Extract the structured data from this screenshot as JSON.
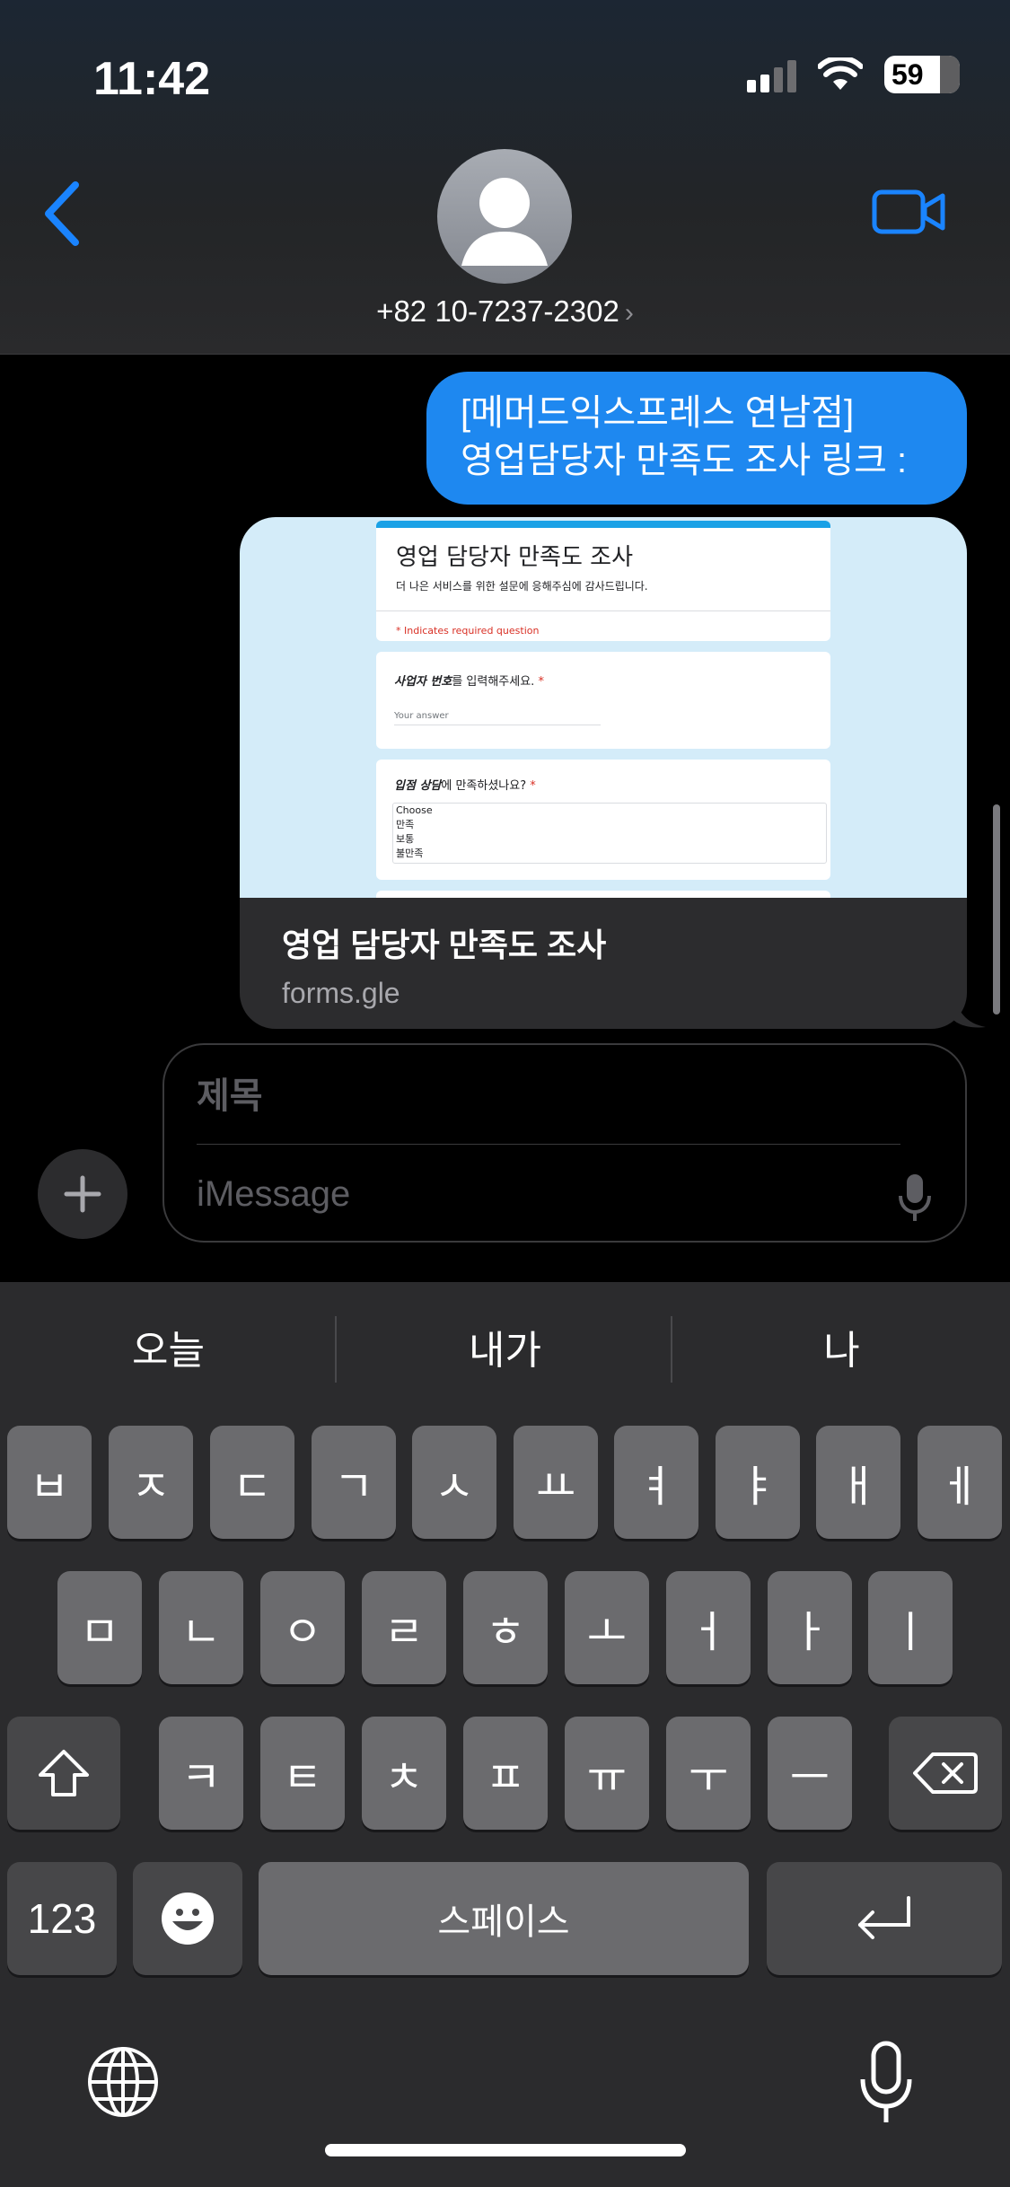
{
  "status_bar": {
    "time": "11:42",
    "battery": "59"
  },
  "header": {
    "contact": "+82 10-7237-2302",
    "contact_chevron": "›"
  },
  "messages": [
    {
      "type": "sent",
      "lines": [
        "[메머드익스프레스 연남점]",
        "영업담당자 만족도 조사 링크 :"
      ]
    }
  ],
  "link_preview": {
    "title": "영업 담당자 만족도 조사",
    "domain": "forms.gle",
    "form": {
      "title": "영업 담당자 만족도 조사",
      "description": "더 나은 서비스를 위한 설문에 응해주심에 감사드립니다.",
      "required_note": "* Indicates required question",
      "q1_bold": "사업자 번호",
      "q1_rest": "를 입력해주세요.",
      "q1_placeholder": "Your answer",
      "q2_bold": "입점 상담",
      "q2_rest": "에 만족하셨나요?",
      "q2_options": [
        "Choose",
        "만족",
        "보통",
        "불만족"
      ],
      "required_star": "*"
    }
  },
  "compose": {
    "subject_placeholder": "제목",
    "message_placeholder": "iMessage"
  },
  "keyboard": {
    "predictions": [
      "오늘",
      "내가",
      "나"
    ],
    "row1": [
      "ㅂ",
      "ㅈ",
      "ㄷ",
      "ㄱ",
      "ㅅ",
      "ㅛ",
      "ㅕ",
      "ㅑ",
      "ㅐ",
      "ㅔ"
    ],
    "row2": [
      "ㅁ",
      "ㄴ",
      "ㅇ",
      "ㄹ",
      "ㅎ",
      "ㅗ",
      "ㅓ",
      "ㅏ",
      "ㅣ"
    ],
    "row3": [
      "ㅋ",
      "ㅌ",
      "ㅊ",
      "ㅍ",
      "ㅠ",
      "ㅜ",
      "ㅡ"
    ],
    "numbers_label": "123",
    "space_label": "스페이스",
    "icons": [
      "shift-icon",
      "delete-icon",
      "emoji-icon",
      "return-icon",
      "globe-icon",
      "dictation-mic-icon"
    ]
  },
  "colors": {
    "bubble_blue": "#1e88f0",
    "accent_blue": "#1a84ff",
    "keyboard_bg": "#2b2b2d",
    "key_light": "#6b6b6e",
    "key_dark": "#474749"
  }
}
